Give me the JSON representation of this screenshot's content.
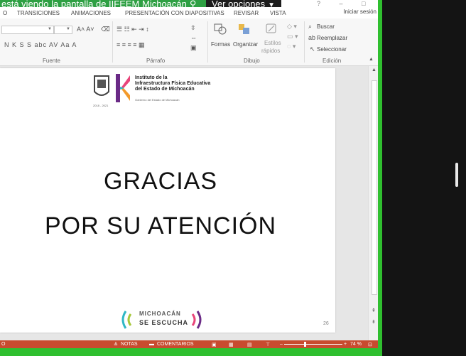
{
  "share_banner": {
    "text": "está viendo la pantalla de IIFEEM Michoacán",
    "view_options_label": "Ver opciones"
  },
  "window": {
    "controls": "?  –  □  ✕"
  },
  "tabs": [
    {
      "label": "O"
    },
    {
      "label": "TRANSICIONES"
    },
    {
      "label": "ANIMACIONES"
    },
    {
      "label": "PRESENTACIÓN CON DIAPOSITIVAS"
    },
    {
      "label": "REVISAR"
    },
    {
      "label": "VISTA"
    }
  ],
  "signin_label": "Iniciar sesión",
  "ribbon": {
    "groups": [
      {
        "label": "Fuente"
      },
      {
        "label": "Párrafo"
      },
      {
        "label": "Dibujo"
      },
      {
        "label": "Edición"
      }
    ],
    "font_format_glyphs": "N  K  S  S  abc  AV  Aa  A",
    "drawing": {
      "shapes_label": "Formas",
      "arrange_label": "Organizar",
      "styles_label_1": "Estilos",
      "styles_label_2": "rápidos"
    },
    "editing": {
      "find_label": "Buscar",
      "replace_label": "Reemplazar",
      "select_label": "Seleccionar"
    }
  },
  "slide": {
    "logo_line1": "Instituto de la",
    "logo_line2": "Infraestructura Física Educativa",
    "logo_line3": "del Estado de Michoacán",
    "logo_sub": "Gobierno del Estado de Michoacán",
    "year_tag": "2018 - 2021",
    "title_line1": "GRACIAS",
    "title_line2": "POR SU ATENCIÓN",
    "footer_logo_line1": "MICHOACÁN",
    "footer_logo_line2": "SE ESCUCHA",
    "slide_number": "26"
  },
  "statusbar": {
    "left": "O",
    "notes_label": "NOTAS",
    "comments_label": "COMENTARIOS",
    "zoom": "74 %"
  },
  "colors": {
    "share_green": "#2ea043",
    "statusbar": "#c84b2f",
    "frame_green": "#2fbf2f"
  }
}
